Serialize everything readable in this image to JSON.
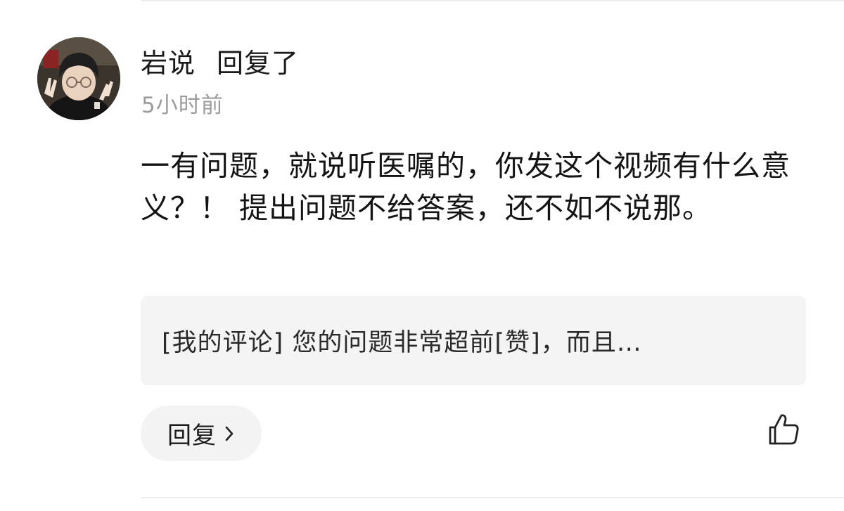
{
  "comment": {
    "user_name": "岩说",
    "action_text": "回复了",
    "timestamp": "5小时前",
    "body": "一有问题，就说听医嘱的，你发这个视频有什么意义？！ 提出问题不给答案，还不如不说那。",
    "quoted_comment": "[我的评论] 您的问题非常超前[赞]，而且…",
    "reply_label": "回复"
  },
  "icons": {
    "avatar": "user-avatar-photo",
    "reply_arrow": "chevron-right-icon",
    "like": "thumbs-up-icon"
  }
}
